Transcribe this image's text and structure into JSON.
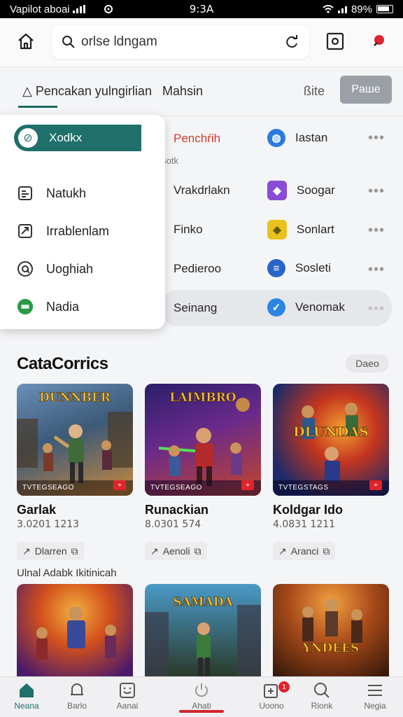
{
  "status_bar": {
    "carrier": "Vapilot aboai",
    "time": "9:3A",
    "battery": "89%"
  },
  "search": {
    "value": "orlse ldngam"
  },
  "tabs": [
    {
      "label": "Pencakan yulngirlian",
      "active": true
    },
    {
      "label": "Mahsin",
      "active": false
    },
    {
      "label": "ite",
      "active": false
    }
  ],
  "tabs_action": "Paше",
  "dropdown": {
    "selected": "Xodkx",
    "items": [
      {
        "label": "Natukh",
        "icon": "list-icon"
      },
      {
        "label": "Irrablenlam",
        "icon": "trend-icon"
      },
      {
        "label": "Uoghiah",
        "icon": "at-icon"
      },
      {
        "label": "Nadia",
        "icon": "green-badge-icon"
      }
    ]
  },
  "apps": {
    "sub_label": "sfic Sotk",
    "left": [
      {
        "label": "Penchŕih",
        "color": "#2f7dd6",
        "glyph": "A"
      },
      {
        "label": "Vrakdrlakn",
        "color": "#c94b2c",
        "glyph": "▰"
      },
      {
        "label": "Finko",
        "color": "#3a3f9f",
        "glyph": "✕"
      },
      {
        "label": "Pedieroo",
        "color": "#f08a24",
        "glyph": "◔"
      },
      {
        "label": "Seinang",
        "color": "#1b1b1b",
        "glyph": "FA"
      }
    ],
    "right": [
      {
        "label": "Iastan",
        "color": "#2a7ae2",
        "glyph": "◍"
      },
      {
        "label": "Soogar",
        "color": "#8a4bd6",
        "glyph": "◆"
      },
      {
        "label": "Sonlart",
        "color": "#e8c21e",
        "glyph": "◆"
      },
      {
        "label": "Sosleti",
        "color": "#2a64c9",
        "glyph": "≡"
      },
      {
        "label": "Venomak",
        "color": "#2a86e0",
        "glyph": "✓"
      }
    ]
  },
  "categories": {
    "title": "CataCorrics",
    "more_label": "Daeo",
    "cards": [
      {
        "image_title": "DUNNBER",
        "tag": "TVTEGSEAGO",
        "title": "Garlak",
        "sub": "3.0201 1213",
        "chip": "Dlarren",
        "bg1": "#5a7fa8",
        "bg2": "#c9883c"
      },
      {
        "image_title": "LAIMBRO",
        "tag": "TVTEGSEAGO",
        "title": "Runackian",
        "sub": "8.0301 574",
        "chip": "Aenoli",
        "bg1": "#3b2a7a",
        "bg2": "#c4452a"
      },
      {
        "image_title": "DLUNDAS",
        "tag": "TVTEGSTAGS",
        "title": "Koldgar Ido",
        "sub": "4.0831 1211",
        "chip": "Aranci",
        "bg1": "#1a3a8a",
        "bg2": "#e2501e"
      }
    ],
    "section_label": "Ulnal Adabk Ikitinicah",
    "cards2": [
      {
        "image_title": "",
        "bg1": "#c94a1c",
        "bg2": "#f2a032"
      },
      {
        "image_title": "SAMADA",
        "bg1": "#3b8ab8",
        "bg2": "#2f4a3a"
      },
      {
        "image_title": "YNDEES",
        "bg1": "#7a2a10",
        "bg2": "#e07a22"
      }
    ]
  },
  "bottom_nav": {
    "items": [
      {
        "label": "Neana",
        "icon": "home-icon",
        "active": true
      },
      {
        "label": "Barlo",
        "icon": "bell-icon",
        "active": false
      },
      {
        "label": "Aanai",
        "icon": "face-icon",
        "active": false
      },
      {
        "label": "Ahati",
        "icon": "power-icon",
        "active": false
      },
      {
        "label": "Uoono",
        "icon": "plus-square-icon",
        "active": false
      },
      {
        "label": "Rionk",
        "icon": "search-icon",
        "active": false
      },
      {
        "label": "Negia",
        "icon": "menu-icon",
        "active": false
      }
    ],
    "badge": "1"
  }
}
